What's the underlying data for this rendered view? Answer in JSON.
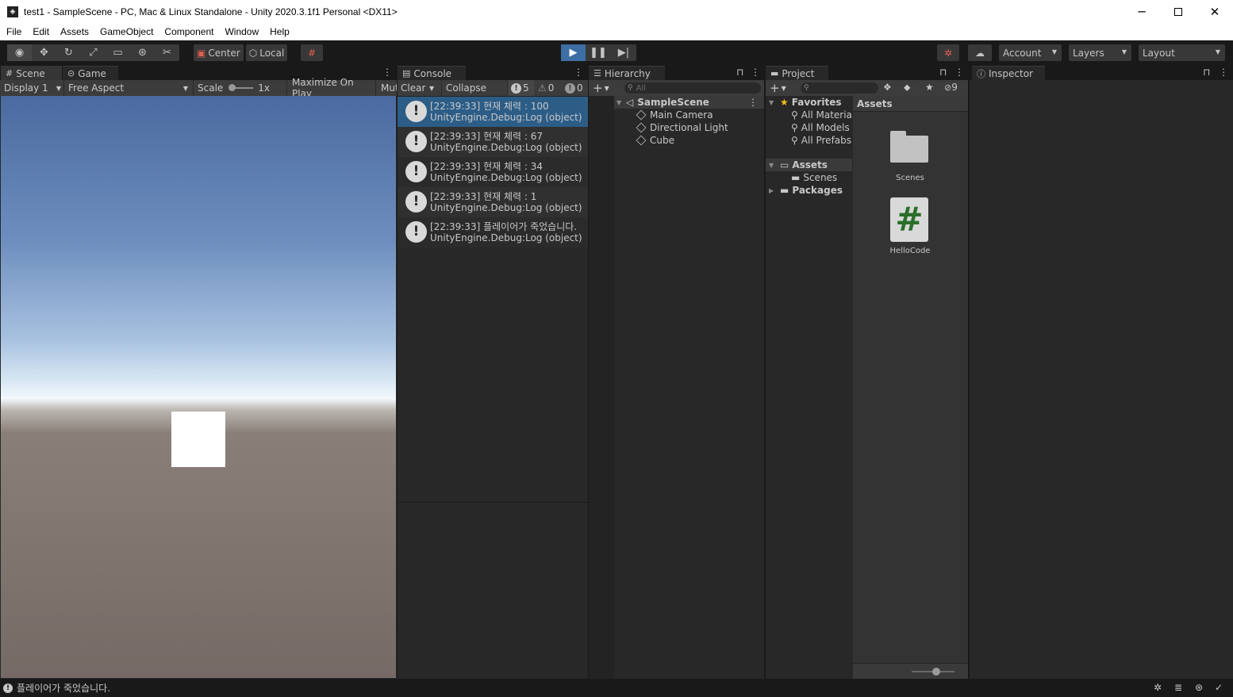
{
  "window": {
    "title": "test1 - SampleScene - PC, Mac & Linux Standalone - Unity 2020.3.1f1 Personal <DX11>",
    "app_icon": "◈"
  },
  "menubar": [
    "File",
    "Edit",
    "Assets",
    "GameObject",
    "Component",
    "Window",
    "Help"
  ],
  "toolbar": {
    "pivot": "Center",
    "space": "Local",
    "account": "Account",
    "layers": "Layers",
    "layout": "Layout"
  },
  "game_panel": {
    "tabs": [
      "Scene",
      "Game"
    ],
    "display": "Display 1",
    "aspect": "Free Aspect",
    "scale_label": "Scale",
    "scale_value": "1x",
    "maximize": "Maximize On Play",
    "mute": "Mut"
  },
  "console": {
    "title": "Console",
    "clear": "Clear",
    "collapse": "Collapse",
    "count_log": "5",
    "count_warn": "0",
    "count_error": "0",
    "entries": [
      {
        "line1": "[22:39:33] 현재 체력 : 100",
        "line2": "UnityEngine.Debug:Log (object)"
      },
      {
        "line1": "[22:39:33] 현재 체력 : 67",
        "line2": "UnityEngine.Debug:Log (object)"
      },
      {
        "line1": "[22:39:33] 현재 체력 : 34",
        "line2": "UnityEngine.Debug:Log (object)"
      },
      {
        "line1": "[22:39:33] 현재 체력 : 1",
        "line2": "UnityEngine.Debug:Log (object)"
      },
      {
        "line1": "[22:39:33] 플레이어가 죽었습니다.",
        "line2": "UnityEngine.Debug:Log (object)"
      }
    ]
  },
  "hierarchy": {
    "title": "Hierarchy",
    "search_placeholder": "All",
    "scene": "SampleScene",
    "objects": [
      "Main Camera",
      "Directional Light",
      "Cube"
    ]
  },
  "project": {
    "title": "Project",
    "hidden_count": "9",
    "favorites": "Favorites",
    "favorite_items": [
      "All Materia",
      "All Models",
      "All Prefabs"
    ],
    "assets": "Assets",
    "asset_folders": [
      "Scenes"
    ],
    "packages": "Packages",
    "breadcrumb": "Assets",
    "grid_items": [
      "Scenes",
      "HelloCode"
    ]
  },
  "inspector": {
    "title": "Inspector"
  },
  "statusbar": {
    "message": "플레이어가 죽었습니다."
  }
}
